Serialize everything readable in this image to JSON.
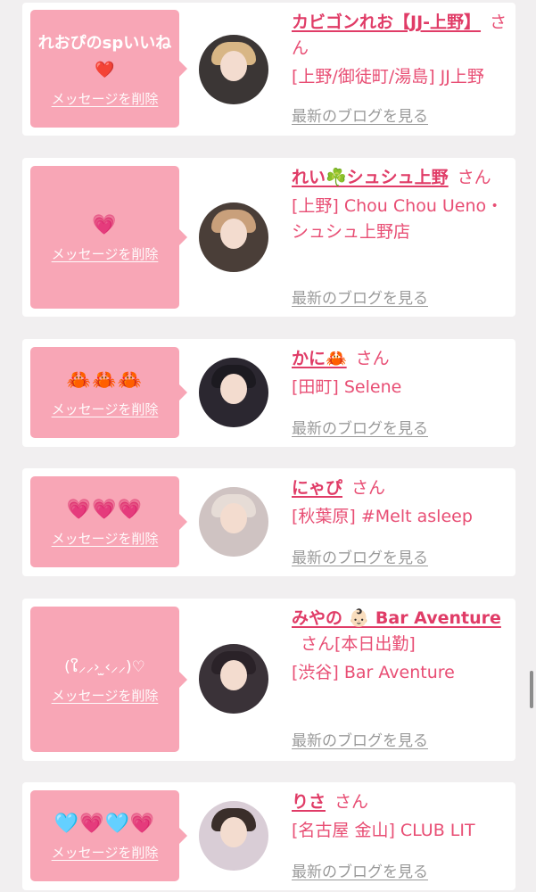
{
  "delete_label": "メッセージを削除",
  "blog_label": "最新のブログを見る",
  "honorific": "さん",
  "colors": {
    "bubble": "#f8a6b6",
    "name": "#e03c67",
    "text": "#e84e74",
    "link_gray": "#9a9a9a"
  },
  "items": [
    {
      "message": "れおぴのspいいね❤️",
      "name": "カビゴンれお【JJ-上野】",
      "suffix": "",
      "shop": "[上野/御徒町/湯島] JJ上野"
    },
    {
      "message": "💗",
      "name": "れい☘️シュシュ上野",
      "suffix": "",
      "shop": "[上野] Chou Chou Ueno・シュシュ上野店"
    },
    {
      "message": "🦀🦀🦀",
      "name": "かに🦀",
      "suffix": "",
      "shop": "[田町] Selene"
    },
    {
      "message": "💗💗💗",
      "name": "にゃぴ",
      "suffix": "",
      "shop": "[秋葉原] #Melt asleep"
    },
    {
      "message": "(ໃ⸝⸝›  ̫‹⸝⸝)♡",
      "name": "みやの 👶🏻 Bar Aventure",
      "suffix": "[本日出勤]",
      "shop": "[渋谷] Bar Aventure"
    },
    {
      "message": "🩵💗🩵💗",
      "name": "りさ",
      "suffix": "",
      "shop": "[名古屋 金山] CLUB LIT"
    }
  ]
}
